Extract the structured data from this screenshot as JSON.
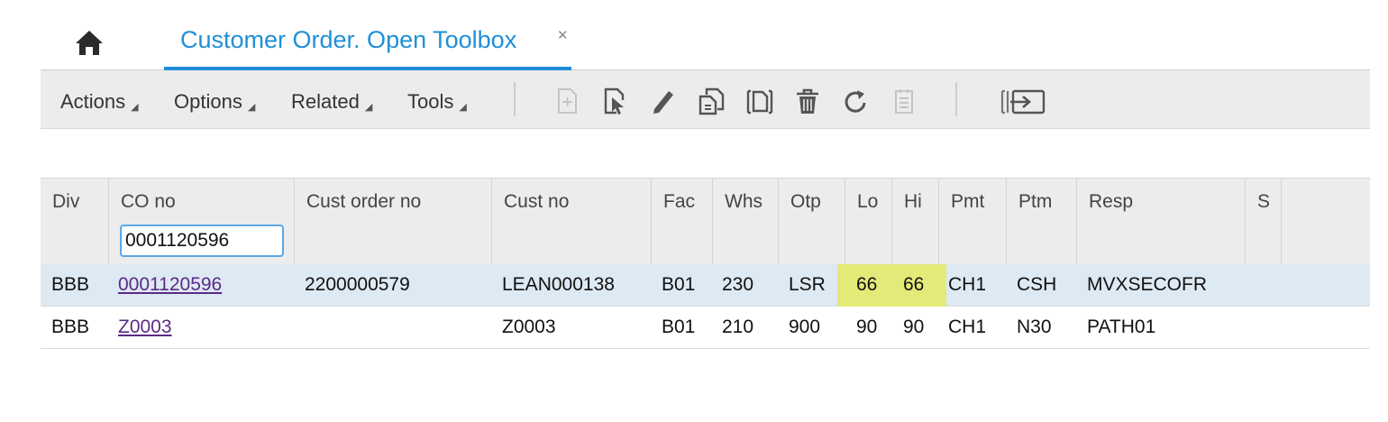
{
  "tabs": {
    "home_label": "Home",
    "active_title": "Customer Order. Open Toolbox",
    "close_glyph": "✕"
  },
  "toolbar": {
    "menus": [
      "Actions",
      "Options",
      "Related",
      "Tools"
    ],
    "icons": [
      "new-icon",
      "select-icon",
      "edit-icon",
      "copy-icon",
      "duplicate-icon",
      "delete-icon",
      "refresh-icon",
      "notes-icon",
      "export-icon"
    ]
  },
  "grid": {
    "columns": [
      "Div",
      "CO no",
      "Cust order no",
      "Cust no",
      "Fac",
      "Whs",
      "Otp",
      "Lo",
      "Hi",
      "Pmt",
      "Ptm",
      "Resp",
      "S"
    ],
    "filter_value": "0001120596",
    "rows": [
      {
        "div": "BBB",
        "co_no": "0001120596",
        "cust_order_no": "2200000579",
        "cust_no": "LEAN000138",
        "fac": "B01",
        "whs": "230",
        "otp": "LSR",
        "lo": "66",
        "hi": "66",
        "pmt": "CH1",
        "ptm": "CSH",
        "resp": "MVXSECOFR",
        "s": ""
      },
      {
        "div": "BBB",
        "co_no": "Z0003",
        "cust_order_no": "",
        "cust_no": "Z0003",
        "fac": "B01",
        "whs": "210",
        "otp": "900",
        "lo": "90",
        "hi": "90",
        "pmt": "CH1",
        "ptm": "N30",
        "resp": "PATH01",
        "s": ""
      }
    ],
    "highlight_color": "#e3ea78",
    "selected_row_color": "#dde9f3"
  }
}
